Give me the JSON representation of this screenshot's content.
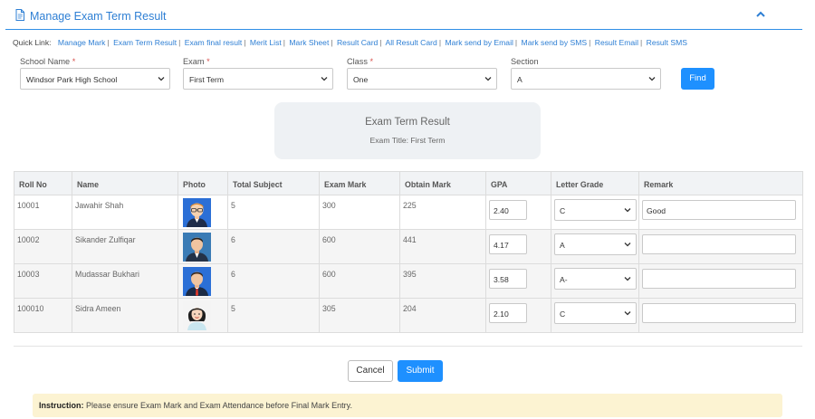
{
  "header": {
    "title": "Manage Exam Term Result",
    "icon": "document-icon",
    "collapse_icon": "chevron-up-icon"
  },
  "quick_links": {
    "label": "Quick Link:",
    "items": [
      "Manage Mark",
      "Exam Term Result",
      "Exam final result",
      "Merit List",
      "Mark Sheet",
      "Result Card",
      "All Result Card",
      "Mark send by Email",
      "Mark send by SMS",
      "Result Email",
      "Result SMS"
    ]
  },
  "filters": {
    "required_mark": "*",
    "school": {
      "label": "School Name",
      "value": "Windsor Park High School"
    },
    "exam": {
      "label": "Exam",
      "value": "First Term"
    },
    "class": {
      "label": "Class",
      "value": "One"
    },
    "section": {
      "label": "Section",
      "value": "A"
    },
    "find_label": "Find"
  },
  "result_box": {
    "title": "Exam Term Result",
    "subtitle": "Exam Title: First Term"
  },
  "table": {
    "headers": [
      "Roll No",
      "Name",
      "Photo",
      "Total Subject",
      "Exam Mark",
      "Obtain Mark",
      "GPA",
      "Letter Grade",
      "Remark"
    ],
    "rows": [
      {
        "roll": "10001",
        "name": "Jawahir Shah",
        "photo": "avatar-man-glasses",
        "total_subject": "5",
        "exam_mark": "300",
        "obtain_mark": "225",
        "gpa": "2.40",
        "grade": "C",
        "remark": "Good"
      },
      {
        "roll": "10002",
        "name": "Sikander Zulfiqar",
        "photo": "avatar-man-suit",
        "total_subject": "6",
        "exam_mark": "600",
        "obtain_mark": "441",
        "gpa": "4.17",
        "grade": "A",
        "remark": ""
      },
      {
        "roll": "10003",
        "name": "Mudassar Bukhari",
        "photo": "avatar-man-tie",
        "total_subject": "6",
        "exam_mark": "600",
        "obtain_mark": "395",
        "gpa": "3.58",
        "grade": "A-",
        "remark": ""
      },
      {
        "roll": "100010",
        "name": "Sidra Ameen",
        "photo": "avatar-woman",
        "total_subject": "5",
        "exam_mark": "305",
        "obtain_mark": "204",
        "gpa": "2.10",
        "grade": "C",
        "remark": ""
      }
    ]
  },
  "actions": {
    "cancel_label": "Cancel",
    "submit_label": "Submit"
  },
  "instruction": {
    "label": "Instruction:",
    "text": "Please ensure Exam Mark and Exam Attendance before Final Mark Entry."
  },
  "colors": {
    "accent": "#1e90ff",
    "link": "#2e7fd4",
    "required": "#d9534f",
    "notice_bg": "#fcf3d2"
  }
}
